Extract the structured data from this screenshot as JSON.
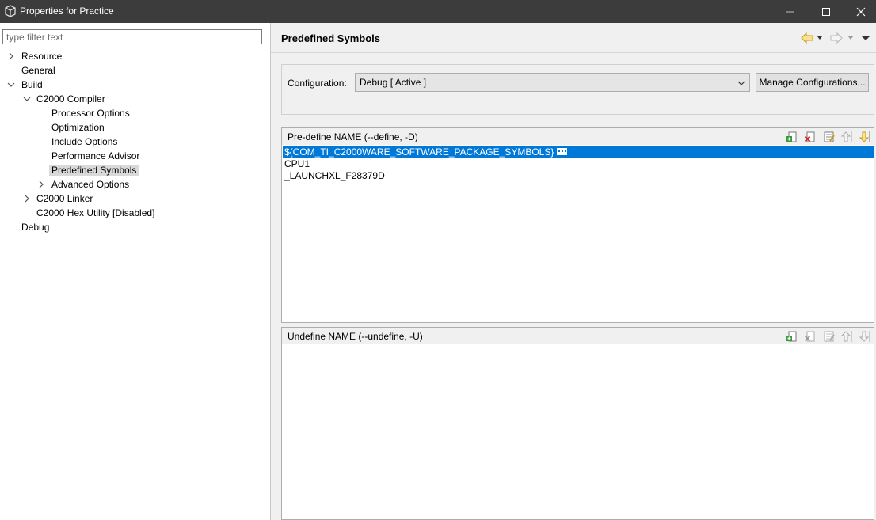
{
  "window": {
    "title": "Properties for Practice"
  },
  "filter": {
    "placeholder": "type filter text"
  },
  "tree": [
    {
      "label": "Resource"
    },
    {
      "label": "General"
    },
    {
      "label": "Build"
    },
    {
      "label": "C2000 Compiler"
    },
    {
      "label": "Processor Options"
    },
    {
      "label": "Optimization"
    },
    {
      "label": "Include Options"
    },
    {
      "label": "Performance Advisor"
    },
    {
      "label": "Predefined Symbols"
    },
    {
      "label": "Advanced Options"
    },
    {
      "label": "C2000 Linker"
    },
    {
      "label": "C2000 Hex Utility  [Disabled]"
    },
    {
      "label": "Debug"
    }
  ],
  "page": {
    "title": "Predefined Symbols"
  },
  "config": {
    "label": "Configuration:",
    "value": "Debug  [ Active ]",
    "manage_label": "Manage Configurations..."
  },
  "predefine": {
    "title": "Pre-define NAME (--define, -D)",
    "items": [
      "${COM_TI_C2000WARE_SOFTWARE_PACKAGE_SYMBOLS}",
      "CPU1",
      "_LAUNCHXL_F28379D"
    ]
  },
  "undefine": {
    "title": "Undefine NAME (--undefine, -U)",
    "items": []
  },
  "colors": {
    "selection": "#0078d7",
    "titlebar": "#3c3c3c"
  }
}
